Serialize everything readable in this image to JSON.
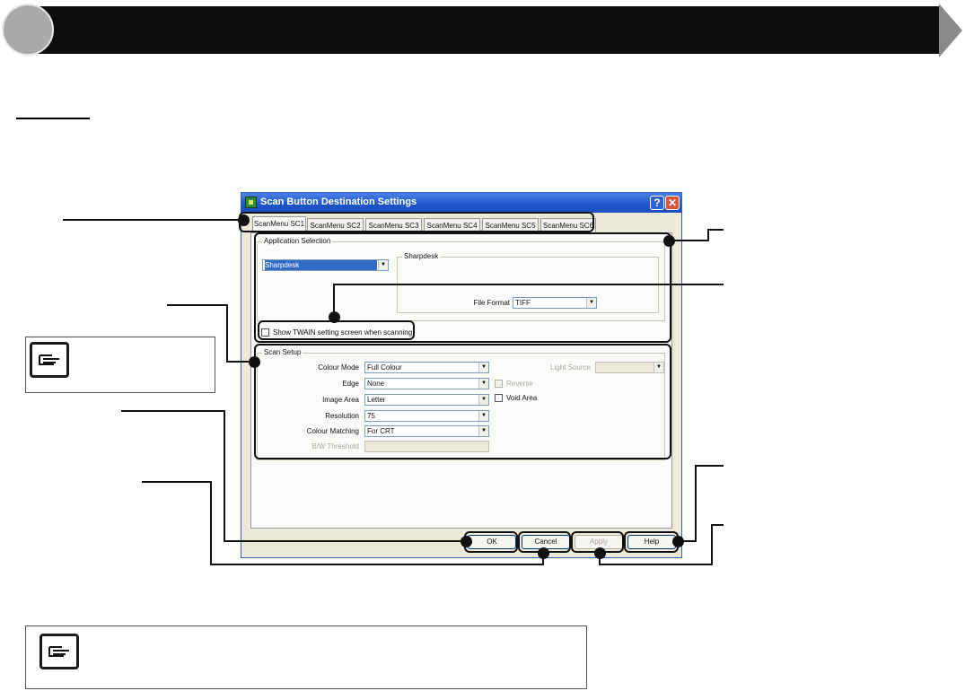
{
  "dialog": {
    "title": "Scan Button Destination Settings",
    "help_glyph": "?",
    "close_glyph": "✕",
    "tabs": [
      "ScanMenu SC1",
      "ScanMenu SC2",
      "ScanMenu SC3",
      "ScanMenu SC4",
      "ScanMenu SC5",
      "ScanMenu SC6"
    ],
    "active_tab": 0,
    "app_selection": {
      "group_label": "Application Selection",
      "application": "Sharpdesk",
      "sub_group_label": "Sharpdesk",
      "file_format_label": "File Format",
      "file_format": "TIFF",
      "twain_label": "Show TWAIN setting screen when scanning",
      "twain_checked": false
    },
    "scan_setup": {
      "group_label": "Scan Setup",
      "colour_mode_label": "Colour Mode",
      "colour_mode": "Full Colour",
      "edge_label": "Edge",
      "edge": "None",
      "image_area_label": "Image Area",
      "image_area": "Letter",
      "resolution_label": "Resolution",
      "resolution": "75",
      "colour_matching_label": "Colour Matching",
      "colour_matching": "For CRT",
      "bw_threshold_label": "B/W Threshold",
      "bw_threshold": "",
      "light_source_label": "Light Source",
      "light_source": "",
      "reverse_label": "Reverse",
      "void_area_label": "Void Area"
    },
    "buttons": {
      "ok": "OK",
      "cancel": "Cancel",
      "apply": "Apply",
      "help": "Help"
    },
    "dropdown_glyph": "▼"
  },
  "colors": {
    "header_bar": "#0d0d0d",
    "titlebar": "#1d55c9",
    "dialog_bg": "#ece9d8",
    "selection": "#316ac5",
    "callout": "#111111"
  },
  "icons": [
    "header-circle-icon",
    "header-arrow-icon",
    "app-icon",
    "help-icon",
    "close-icon",
    "dropdown-icon",
    "note-hand-icon"
  ]
}
